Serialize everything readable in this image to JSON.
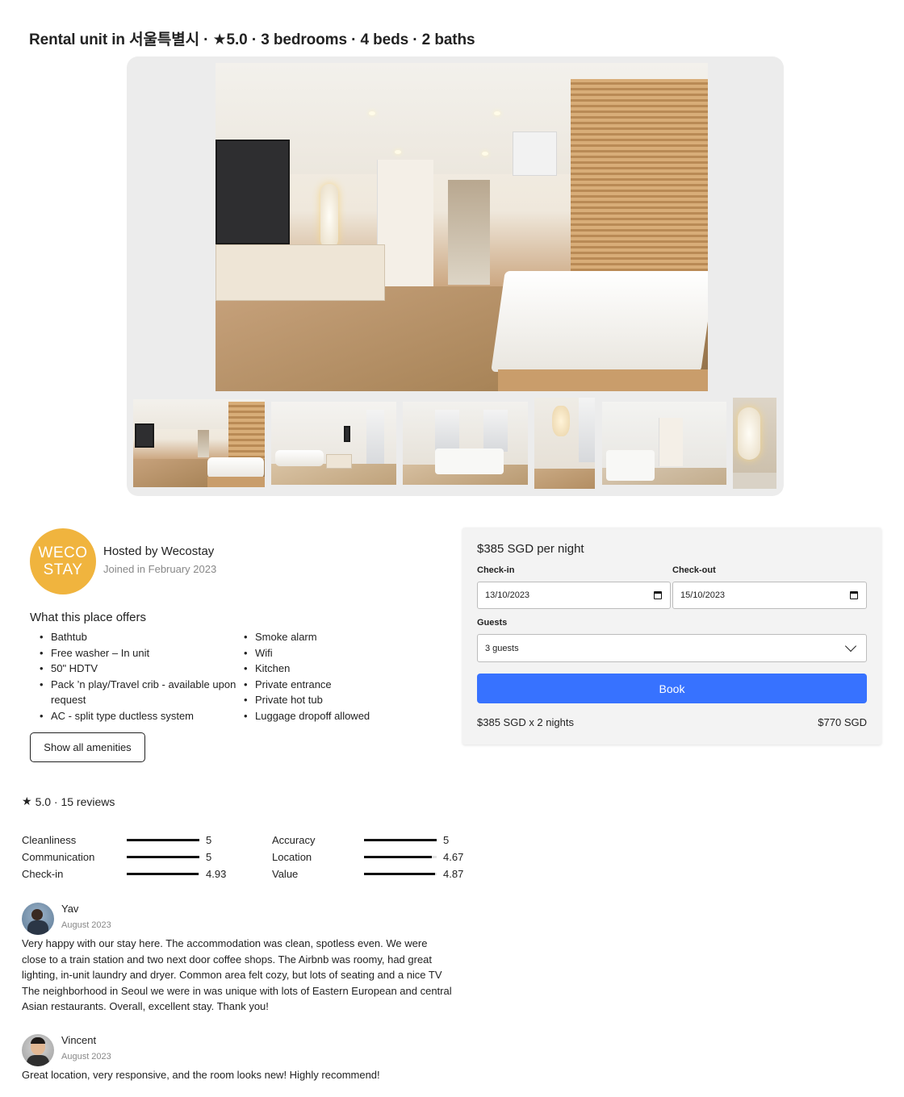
{
  "listing": {
    "title": "Rental unit in 서울특별시 · ★5.0 · 3 bedrooms · 4 beds · 2 baths"
  },
  "gallery": {
    "main_photo": "living-room-photo",
    "thumbnails": [
      "living-room-photo",
      "lounge-photo",
      "bedroom-photo",
      "lamp-corner-photo",
      "bedroom-2-photo",
      "mirror-photo"
    ]
  },
  "host": {
    "avatar_line1": "WECO",
    "avatar_line2": "STAY",
    "name": "Hosted by Wecostay",
    "joined": "Joined in February 2023",
    "avatar_color": "#f0b43e"
  },
  "amenities": {
    "title": "What this place offers",
    "left": [
      "Bathtub",
      "Free washer – In unit",
      "50\" HDTV",
      "Pack ’n play/Travel crib - available upon request",
      "AC - split type ductless system"
    ],
    "right": [
      "Smoke alarm",
      "Wifi",
      "Kitchen",
      "Private entrance",
      "Private hot tub",
      "Luggage dropoff allowed"
    ],
    "show_all_label": "Show all amenities"
  },
  "booking": {
    "price_per_night": "$385 SGD per night",
    "checkin_label": "Check-in",
    "checkin_value": "13/10/2023",
    "checkout_label": "Check-out",
    "checkout_value": "15/10/2023",
    "guests_label": "Guests",
    "guests_value": "3 guests",
    "book_label": "Book",
    "calc_label": "$385 SGD x 2 nights",
    "calc_total": "$770 SGD",
    "accent_color": "#3772ff"
  },
  "reviews": {
    "summary": "5.0 · 15 reviews",
    "categories": [
      {
        "label": "Cleanliness",
        "value": "5",
        "fraction": 1.0
      },
      {
        "label": "Communication",
        "value": "5",
        "fraction": 1.0
      },
      {
        "label": "Check-in",
        "value": "4.93",
        "fraction": 0.986
      },
      {
        "label": "Accuracy",
        "value": "5",
        "fraction": 1.0
      },
      {
        "label": "Location",
        "value": "4.67",
        "fraction": 0.934
      },
      {
        "label": "Value",
        "value": "4.87",
        "fraction": 0.974
      }
    ],
    "items": [
      {
        "name": "Yav",
        "date": "August 2023",
        "text": "Very happy with our stay here. The accommodation was clean, spotless even. We were close to a train station and two next door coffee shops. The Airbnb was roomy, had great lighting, in-unit laundry and dryer. Common area felt cozy, but lots of seating and a nice TV The neighborhood in Seoul we were in was unique with lots of Eastern European and central Asian restaurants. Overall, excellent stay. Thank you!"
      },
      {
        "name": "Vincent",
        "date": "August 2023",
        "text": "Great location, very responsive, and the room looks new! Highly recommend!"
      }
    ]
  }
}
